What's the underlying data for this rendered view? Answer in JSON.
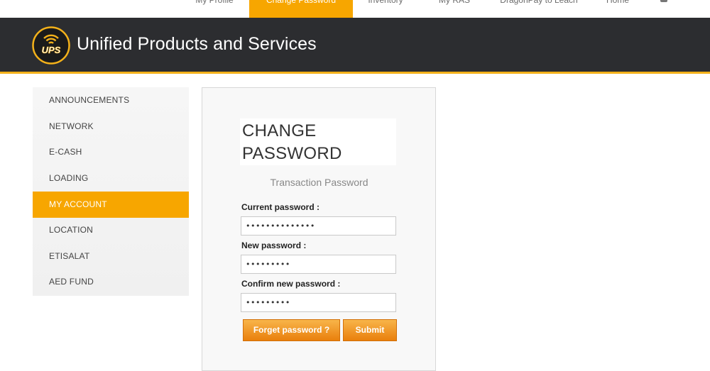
{
  "topnav": {
    "tabs": [
      {
        "label": "My Profile",
        "active": false
      },
      {
        "label": "Change Password",
        "active": true
      },
      {
        "label": "Inventory",
        "active": false
      },
      {
        "label": "My RAS",
        "active": false
      },
      {
        "label": "DragonPay to Leach",
        "active": false
      },
      {
        "label": "Home",
        "active": false
      }
    ]
  },
  "header": {
    "logo_text": "UPS",
    "title": "Unified Products and Services"
  },
  "sidebar": {
    "items": [
      {
        "label": "ANNOUNCEMENTS",
        "active": false
      },
      {
        "label": "NETWORK",
        "active": false
      },
      {
        "label": "E-CASH",
        "active": false
      },
      {
        "label": "LOADING",
        "active": false
      },
      {
        "label": "MY ACCOUNT",
        "active": true
      },
      {
        "label": "LOCATION",
        "active": false
      },
      {
        "label": "ETISALAT",
        "active": false
      },
      {
        "label": "AED FUND",
        "active": false
      }
    ]
  },
  "form": {
    "title": "CHANGE PASSWORD",
    "subtitle": "Transaction Password",
    "current_label": "Current password :",
    "current_value": "••••••••••••••",
    "new_label": "New password :",
    "new_value": "•••••••••",
    "confirm_label": "Confirm new password :",
    "confirm_value": "•••••••••",
    "forget_button": "Forget password ?",
    "submit_button": "Submit"
  },
  "colors": {
    "accent": "#f7a600",
    "header_bg": "#2c2d30",
    "header_stripe": "#f3b11a",
    "button_top": "#f8b54a",
    "button_bottom": "#e97f0c"
  }
}
